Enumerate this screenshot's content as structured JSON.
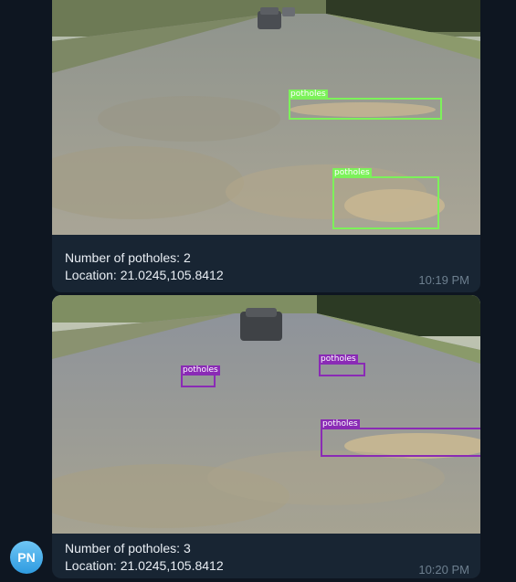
{
  "messages": [
    {
      "caption_line1": "Number of potholes: 2",
      "caption_line2": "Location: 21.0245,105.8412",
      "time": "10:19 PM",
      "detections": [
        {
          "label": "potholes"
        },
        {
          "label": "potholes"
        }
      ],
      "box_color": "#7cf25a"
    },
    {
      "caption_line1": "Number of potholes: 3",
      "caption_line2": "Location: 21.0245,105.8412",
      "time": "10:20 PM",
      "detections": [
        {
          "label": "potholes"
        },
        {
          "label": "potholes"
        },
        {
          "label": "potholes"
        }
      ],
      "box_color": "#8a2bb5"
    }
  ],
  "sender": {
    "initials": "PN",
    "avatar_color": "#3aa7e8"
  }
}
